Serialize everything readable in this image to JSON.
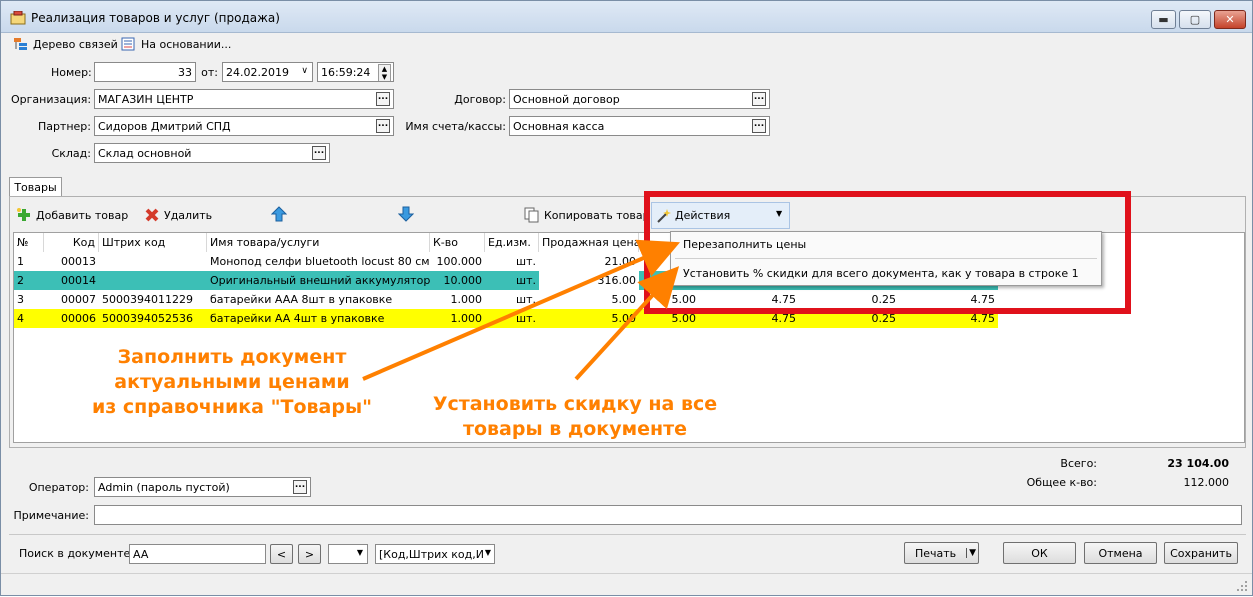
{
  "window": {
    "title": "Реализация товаров и услуг (продажа)",
    "minimize": "▬",
    "maximize": "▢",
    "close": "✕"
  },
  "toolbar": {
    "tree_label": "Дерево связей",
    "based_on_label": "На основании..."
  },
  "header": {
    "number_label": "Номер:",
    "number_value": "33",
    "date_label": "от:",
    "date_value": "24.02.2019",
    "time_value": "16:59:24",
    "org_label": "Организация:",
    "org_value": "МАГАЗИН ЦЕНТР",
    "partner_label": "Партнер:",
    "partner_value": "Сидоров Дмитрий СПД",
    "warehouse_label": "Склад:",
    "warehouse_value": "Склад основной",
    "contract_label": "Договор:",
    "contract_value": "Основной договор",
    "account_label": "Имя счета/кассы:",
    "account_value": "Основная касса"
  },
  "tabs": [
    {
      "label": "Товары"
    }
  ],
  "goods_toolbar": {
    "add_label": "Добавить товар",
    "delete_label": "Удалить",
    "copy_label": "Копировать товар",
    "actions_label": "Действия"
  },
  "grid": {
    "columns": [
      "№",
      "Код",
      "Штрих код",
      "Имя товара/услуги",
      "К-во",
      "Ед.изм.",
      "Продажная цена"
    ],
    "rows": [
      {
        "n": "1",
        "code": "00013",
        "barcode": "",
        "name": "Монопод селфи bluetooth locust 80 см",
        "qty": "100.000",
        "unit": "шт.",
        "price": "21.00",
        "c8": "",
        "c9": "",
        "c10": "",
        "c11": ""
      },
      {
        "n": "2",
        "code": "00014",
        "barcode": "",
        "name": "Оригинальный внешний аккумулятор xi...",
        "qty": "10.000",
        "unit": "шт.",
        "price": "316.00",
        "c8": "",
        "c9": "",
        "c10": "",
        "c11": ""
      },
      {
        "n": "3",
        "code": "00007",
        "barcode": "5000394011229",
        "name": "батарейки AAA 8шт в упаковке",
        "qty": "1.000",
        "unit": "шт.",
        "price": "5.00",
        "c8": "5.00",
        "c9": "4.75",
        "c10": "0.25",
        "c11": "4.75"
      },
      {
        "n": "4",
        "code": "00006",
        "barcode": "5000394052536",
        "name": "батарейки AA 4шт в упаковке",
        "qty": "1.000",
        "unit": "шт.",
        "price": "5.00",
        "c8": "5.00",
        "c9": "4.75",
        "c10": "0.25",
        "c11": "4.75"
      }
    ]
  },
  "menu": {
    "item1": "Перезаполнить цены",
    "item2": "Установить % скидки для всего документа, как у товара в строке 1"
  },
  "annotations": {
    "left_line1": "Заполнить документ",
    "left_line2": "актуальными ценами",
    "left_line3": "из справочника \"Товары\"",
    "right_line1": "Установить скидку на все",
    "right_line2": "товары в документе"
  },
  "totals": {
    "total_label": "Всего:",
    "total_value": "23 104.00",
    "qty_label": "Общее к-во:",
    "qty_value": "112.000"
  },
  "footer": {
    "operator_label": "Оператор:",
    "operator_value": "Admin (пароль пустой)",
    "note_label": "Примечание:",
    "note_value": "",
    "search_label": "Поиск в документе:",
    "search_value": "AA",
    "prev": "<",
    "next": ">",
    "search_fields": "[Код,Штрих код,И",
    "print_label": "Печать",
    "ok_label": "ОК",
    "cancel_label": "Отмена",
    "save_label": "Сохранить"
  },
  "colors": {
    "selected_row": "#3cbfb6",
    "highlight_row": "#ffff00",
    "annotation": "#ff8000",
    "frame": "#e0111b"
  }
}
